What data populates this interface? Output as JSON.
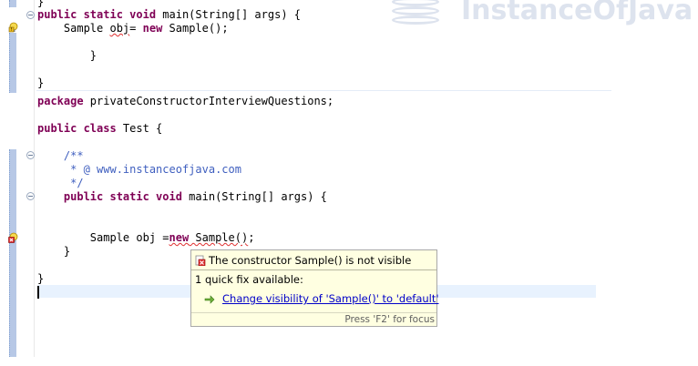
{
  "watermark": {
    "text": "InstanceOfJava"
  },
  "code_lines": [
    {
      "text": "}"
    },
    {
      "kw1": "public static void",
      "rest": " main(String[] args) {"
    },
    {
      "pre": "    Sample ",
      "err": "obj",
      "post": "= ",
      "kw": "new",
      "tail": " Sample();"
    },
    {
      "text": "        }"
    },
    {
      "text": "}"
    },
    {
      "kw1": "package",
      "rest": " privateConstructorInterviewQuestions;"
    },
    {
      "kw1": "public class",
      "rest": " Test {"
    },
    {
      "doc": "    /**"
    },
    {
      "doc": "     * @ www.instanceofjava.com"
    },
    {
      "doc": "     */"
    },
    {
      "pre": "    ",
      "kw1": "public static void",
      "rest": " main(String[] args) {"
    },
    {
      "pre": "        Sample obj =",
      "errkw": "new",
      "err2": " Sample()",
      "tail": ";"
    },
    {
      "text": "    }"
    },
    {
      "text": "}"
    }
  ],
  "popup": {
    "title": "The constructor Sample() is not visible",
    "count": "1 quick fix available:",
    "fix_label": "Change visibility of 'Sample()' to 'default'",
    "status": "Press 'F2' for focus"
  },
  "icons": {
    "error": "error-icon",
    "warning": "warning-lightbulb-icon",
    "quickfix": "change-arrow-icon"
  },
  "colors": {
    "keyword": "#7f0055",
    "javadoc": "#3f5fbf",
    "popup_bg": "#ffffe1",
    "link": "#0000c8"
  }
}
